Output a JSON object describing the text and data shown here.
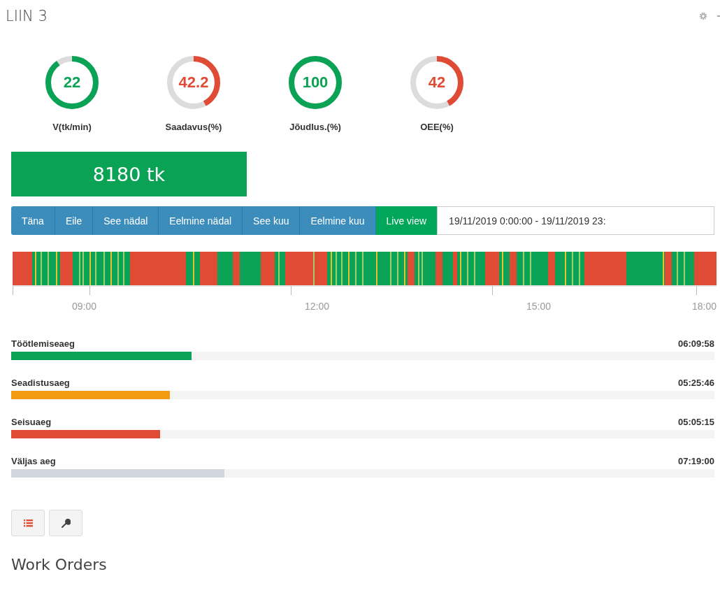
{
  "title": "LIIN 3",
  "gauges": [
    {
      "value": "22",
      "label": "V(tk/min)",
      "level": 0.9,
      "color": "#0aa355"
    },
    {
      "value": "42.2",
      "label": "Saadavus(%)",
      "level": 0.422,
      "color": "#e04b35"
    },
    {
      "value": "100",
      "label": "Jõudlus.(%)",
      "level": 1,
      "color": "#0aa355"
    },
    {
      "value": "42",
      "label": "OEE(%)",
      "level": 0.42,
      "color": "#e04b35"
    }
  ],
  "count": "8180 tk",
  "range_buttons": [
    {
      "label": "Täna",
      "selected": false
    },
    {
      "label": "Eile",
      "selected": false
    },
    {
      "label": "See nädal",
      "selected": false
    },
    {
      "label": "Eelmine nädal",
      "selected": false
    },
    {
      "label": "See kuu",
      "selected": false
    },
    {
      "label": "Eelmine kuu",
      "selected": false
    },
    {
      "label": "Live view",
      "selected": true
    }
  ],
  "date_range": {
    "value": "19/11/2019 0:00:00 - 19/11/2019 23:"
  },
  "timeline": {
    "ticks": [
      "09:00",
      "12:00",
      "15:00",
      "18:00"
    ]
  },
  "durations": [
    {
      "label": "Töötlemiseaeg",
      "time": "06:09:58",
      "level": 0.256,
      "color": "#0aa355"
    },
    {
      "label": "Seadistusaeg",
      "time": "05:25:46",
      "level": 0.226,
      "color": "#f39c12"
    },
    {
      "label": "Seisuaeg",
      "time": "05:05:15",
      "level": 0.212,
      "color": "#e04b35"
    },
    {
      "label": "Väljas aeg",
      "time": "07:19:00",
      "level": 0.303,
      "color": "#d2d6de"
    }
  ],
  "section_title": "Work Orders"
}
